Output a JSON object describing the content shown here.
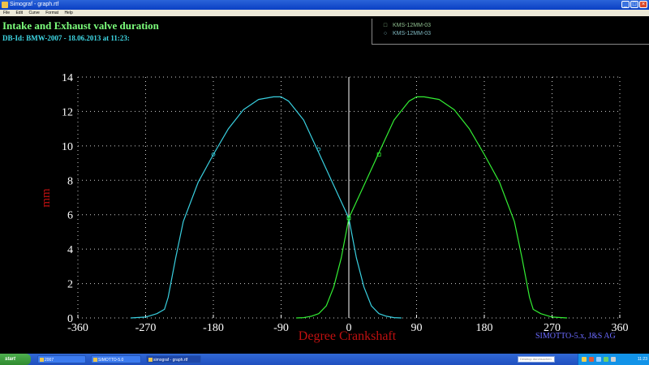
{
  "window": {
    "title": "Simograf - graph.rtf"
  },
  "menu": [
    "File",
    "Edit",
    "Curve",
    "Format",
    "Help"
  ],
  "header": {
    "title": "Intake and Exhaust valve duration",
    "subtitle": "DB-Id: BMW-2007 - 18.06.2013 at 11:23:"
  },
  "legend": [
    {
      "label": "KMS-12MM-03",
      "marker": "□"
    },
    {
      "label": "KMS-12MM-03",
      "marker": "○"
    }
  ],
  "credit": "SIMOTTO-5.x, J&S AG",
  "colors": {
    "background": "#000000",
    "intake": "#33ee33",
    "exhaust": "#39d0e0",
    "grid": "#d0d0d0",
    "axis_label": "#c01010",
    "tdc_line": "#ffffff"
  },
  "chart_data": {
    "type": "line",
    "xlabel": "Degree Crankshaft",
    "ylabel": "mm",
    "xlim": [
      -360,
      360
    ],
    "ylim": [
      0,
      14
    ],
    "x_ticks": [
      -360,
      -270,
      -180,
      -90,
      0,
      90,
      180,
      270,
      360
    ],
    "y_ticks": [
      0,
      2,
      4,
      6,
      8,
      10,
      12,
      14
    ],
    "grid": true,
    "series": [
      {
        "color": "#39d0e0",
        "marker": "circle",
        "x": [
          -290,
          -270,
          -255,
          -245,
          -240,
          -230,
          -220,
          -200,
          -180,
          -160,
          -140,
          -120,
          -100,
          -90,
          -80,
          -60,
          -40,
          -20,
          0,
          10,
          20,
          30,
          40,
          50,
          60,
          70
        ],
        "y": [
          0,
          0.05,
          0.25,
          0.5,
          1.2,
          3.5,
          5.6,
          7.9,
          9.5,
          11.0,
          12.1,
          12.7,
          12.85,
          12.85,
          12.6,
          11.5,
          9.6,
          7.7,
          5.8,
          3.5,
          1.8,
          0.7,
          0.25,
          0.1,
          0.02,
          0
        ],
        "marked_points": [
          [
            -180,
            9.5
          ],
          [
            -40,
            9.8
          ],
          [
            0,
            5.8
          ]
        ]
      },
      {
        "color": "#33ee33",
        "marker": "square",
        "x": [
          -70,
          -60,
          -50,
          -40,
          -30,
          -20,
          -10,
          0,
          20,
          40,
          60,
          80,
          90,
          100,
          120,
          140,
          160,
          180,
          200,
          220,
          230,
          240,
          245,
          255,
          270,
          290
        ],
        "y": [
          0,
          0.02,
          0.1,
          0.25,
          0.7,
          1.8,
          3.5,
          5.8,
          7.7,
          9.6,
          11.5,
          12.6,
          12.85,
          12.85,
          12.7,
          12.1,
          11.0,
          9.5,
          7.9,
          5.6,
          3.5,
          1.2,
          0.5,
          0.25,
          0.05,
          0
        ],
        "marked_points": [
          [
            0,
            5.8
          ],
          [
            40,
            9.5
          ]
        ]
      }
    ]
  },
  "taskbar": {
    "start": "start",
    "tasks": [
      "2007",
      "SIMOTTO-5.0",
      "simograf - graph.rtf"
    ],
    "search_placeholder": "Desktop durchsuchen",
    "clock": "11:23"
  }
}
